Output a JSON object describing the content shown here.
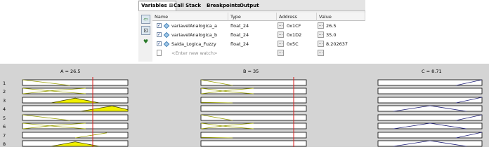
{
  "watch": {
    "tabs": [
      {
        "label": "Variables",
        "close": "⊠"
      },
      {
        "label": "Call Stack"
      },
      {
        "label": "Breakpoints"
      },
      {
        "label": "Output"
      }
    ],
    "columns": {
      "name": "Name",
      "type": "Type",
      "address": "Address",
      "value": "Value"
    },
    "rows": [
      {
        "name": "variavelAnalogica_a",
        "type": "float_24",
        "address": "0x1CF",
        "value": "26.5",
        "checked": true
      },
      {
        "name": "variavelAnalogica_b",
        "type": "float_24",
        "address": "0x1D2",
        "value": "35.0",
        "checked": true
      },
      {
        "name": "Saida_Logica_Fuzzy",
        "type": "float_24",
        "address": "0x5C",
        "value": "8.202637",
        "checked": true
      }
    ],
    "new_watch_placeholder": "<Enter new watch>",
    "tool_icons": [
      "add-watch-icon",
      "remove-watch-icon",
      "watch-properties-icon"
    ],
    "browse_button_label": "..."
  },
  "fuzzy": {
    "panels": [
      {
        "title": "A = 26.5",
        "color": "#9aa000",
        "marker": true
      },
      {
        "title": "B = 35",
        "color": "#9aa000",
        "marker": true
      },
      {
        "title": "C = 8.71",
        "color": "#1e1e78",
        "marker": false
      }
    ],
    "row_labels": [
      "1",
      "2",
      "3",
      "4",
      "5",
      "6",
      "7",
      "8"
    ],
    "marker_color": "#d81e1e",
    "fill_color": "#f0f000"
  }
}
